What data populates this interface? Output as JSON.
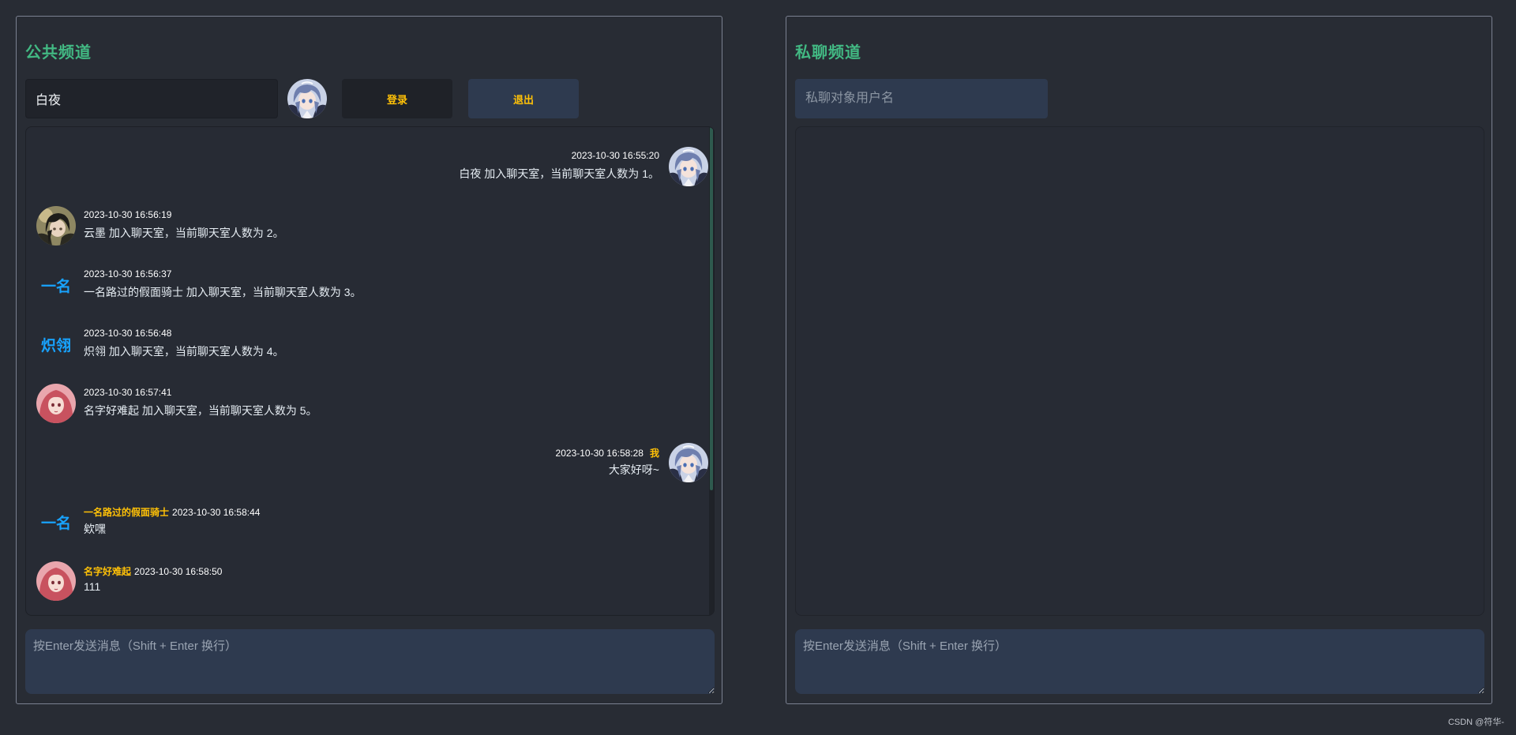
{
  "public": {
    "title": "公共频道",
    "username_value": "白夜",
    "login_label": "登录",
    "logout_label": "退出",
    "input_placeholder": "按Enter发送消息（Shift + Enter 换行）",
    "messages": [
      {
        "time": "2023-10-30 16:55:20",
        "text": "白夜 加入聊天室，当前聊天室人数为 1。"
      },
      {
        "time": "2023-10-30 16:56:19",
        "text": "云墨 加入聊天室，当前聊天室人数为 2。"
      },
      {
        "avatar_text": "一名",
        "time": "2023-10-30 16:56:37",
        "text": "一名路过的假面骑士 加入聊天室，当前聊天室人数为 3。"
      },
      {
        "avatar_text": "炽翎",
        "time": "2023-10-30 16:56:48",
        "text": "炽翎 加入聊天室，当前聊天室人数为 4。"
      },
      {
        "time": "2023-10-30 16:57:41",
        "text": "名字好难起 加入聊天室，当前聊天室人数为 5。"
      },
      {
        "time": "2023-10-30 16:58:28",
        "me": "我",
        "text": "大家好呀~"
      },
      {
        "avatar_text": "一名",
        "sender": "一名路过的假面骑士",
        "time": "2023-10-30 16:58:44",
        "text": "欸嘿"
      },
      {
        "sender": "名字好难起",
        "time": "2023-10-30 16:58:50",
        "text": "111"
      }
    ]
  },
  "private": {
    "title": "私聊频道",
    "target_placeholder": "私聊对象用户名",
    "input_placeholder": "按Enter发送消息（Shift + Enter 换行）"
  },
  "watermark": "CSDN @符华-",
  "colors": {
    "accent_title": "#42b983",
    "accent_button": "#ffc107",
    "text_avatar": "#18a3ff",
    "background": "#282c34"
  },
  "icons": {
    "avatar_me": "anime-girl-blue-hair-avatar",
    "avatar_yunmo": "anime-dark-hair-avatar",
    "avatar_mingzi": "anime-pink-hair-avatar"
  }
}
